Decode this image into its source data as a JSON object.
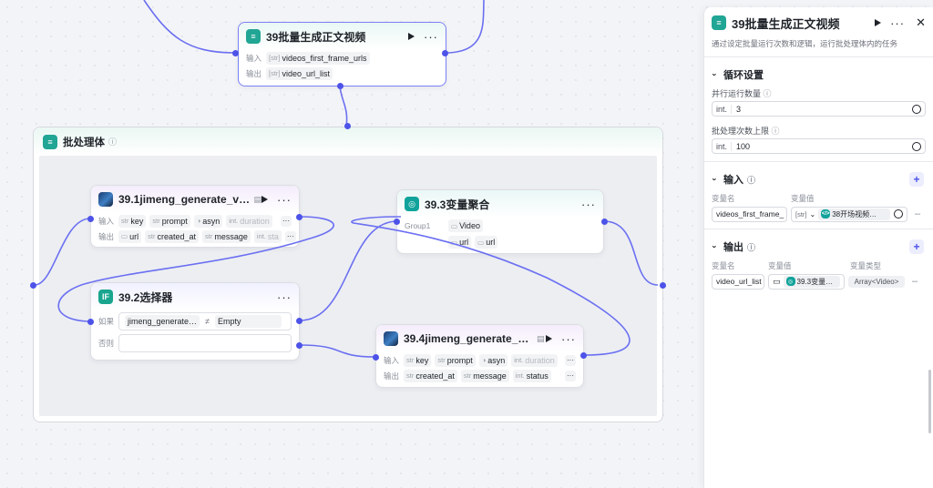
{
  "batch_node": {
    "title": "39批量生成正文视频",
    "input_label": "输入",
    "input_value": "videos_first_frame_urls",
    "output_label": "输出",
    "output_value": "video_url_list"
  },
  "group": {
    "title": "批处理体"
  },
  "node_jimeng1": {
    "title": "39.1jimeng_generate_video",
    "input_label": "输入",
    "output_label": "输出",
    "inputs": [
      {
        "type": "str",
        "name": "key"
      },
      {
        "type": "str",
        "name": "prompt"
      },
      {
        "type": "",
        "name": "asyn"
      },
      {
        "type": "int.",
        "name": "duration"
      }
    ],
    "outputs": [
      {
        "type": "",
        "name": "url"
      },
      {
        "type": "str",
        "name": "created_at"
      },
      {
        "type": "str",
        "name": "message"
      },
      {
        "type": "int.",
        "name": "sta"
      }
    ]
  },
  "node_agg": {
    "title": "39.3变量聚合",
    "group_label": "Group1",
    "items": [
      "Video",
      "url",
      "url"
    ]
  },
  "node_selector": {
    "title": "39.2选择器",
    "if_label": "如果",
    "else_label": "否则",
    "left_operand": "jimeng_generate…",
    "operator": "≠",
    "right_operand": "Empty"
  },
  "node_jimeng4": {
    "title": "39.4jimeng_generate_video…",
    "input_label": "输入",
    "output_label": "输出",
    "inputs": [
      {
        "type": "str",
        "name": "key"
      },
      {
        "type": "str",
        "name": "prompt"
      },
      {
        "type": "",
        "name": "asyn"
      },
      {
        "type": "int.",
        "name": "duration"
      }
    ],
    "outputs": [
      {
        "type": "str",
        "name": "created_at"
      },
      {
        "type": "str",
        "name": "message"
      },
      {
        "type": "int.",
        "name": "status"
      }
    ]
  },
  "panel": {
    "title": "39批量生成正文视频",
    "description": "通过设定批量运行次数和逻辑，运行批处理体内的任务",
    "loop_section": "循环设置",
    "parallel_label": "并行运行数量",
    "parallel_prefix": "int.",
    "parallel_value": "3",
    "max_label": "批处理次数上限",
    "max_prefix": "int.",
    "max_value": "100",
    "input_section": "输入",
    "var_name_col": "变量名",
    "var_value_col": "变量值",
    "input_var_name": "videos_first_frame_",
    "input_var_value": "38开场视频…",
    "output_section": "输出",
    "var_type_col": "变量类型",
    "output_var_name": "video_url_list",
    "output_var_value": "39.3变量…",
    "output_var_type": "Array<Video>"
  },
  "colors": {
    "edge": "#6b6ff1",
    "accent": "#4d53e8",
    "batch_icon": "#21a594"
  }
}
